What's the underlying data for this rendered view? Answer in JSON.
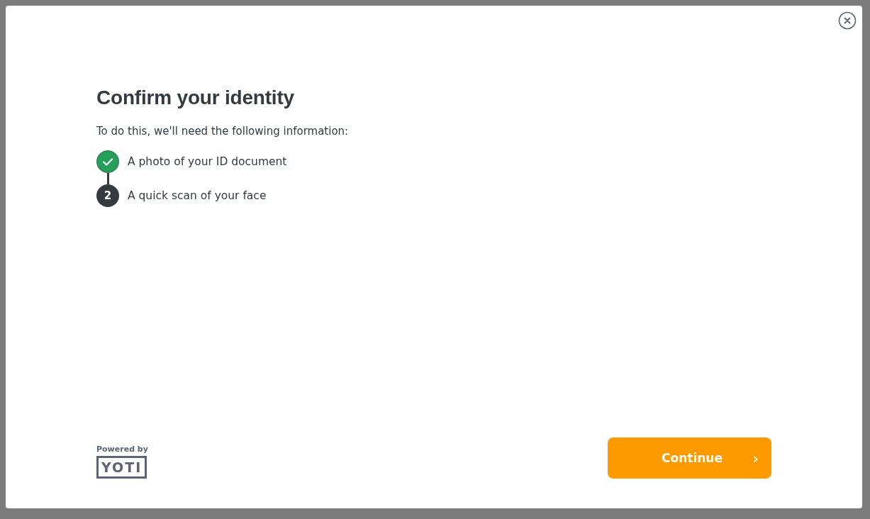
{
  "dialog": {
    "title": "Confirm your identity",
    "intro": "To do this, we'll need the following information:",
    "steps": [
      {
        "label": "A photo of your ID document",
        "done": true
      },
      {
        "label": "A quick scan of your face",
        "done": false,
        "number": "2"
      }
    ],
    "powered_by": {
      "caption": "Powered by",
      "logo": "YOTI"
    },
    "continue_button": {
      "label": "Continue",
      "arrow": "›"
    }
  }
}
